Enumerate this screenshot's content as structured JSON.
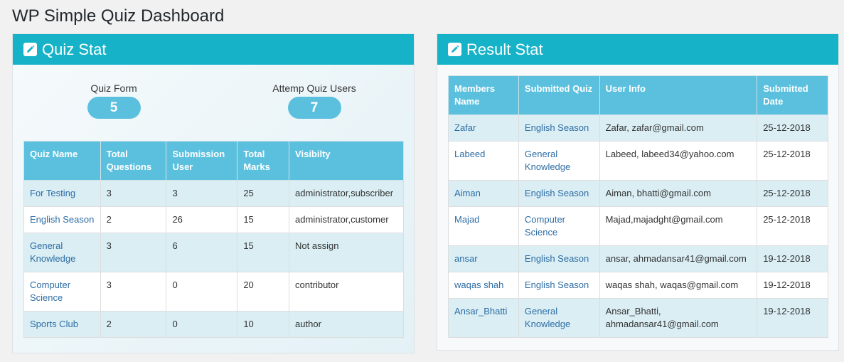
{
  "page": {
    "title": "WP Simple Quiz Dashboard"
  },
  "quiz_stat": {
    "title": "Quiz Stat",
    "icon": "edit-icon",
    "quiz_form_label": "Quiz Form",
    "quiz_form_count": "5",
    "attempt_label": "Attemp Quiz Users",
    "attempt_count": "7",
    "headers": [
      "Quiz Name",
      "Total Questions",
      "Submission User",
      "Total Marks",
      "Visibilty"
    ],
    "rows": [
      {
        "name": "For Testing",
        "questions": "3",
        "submissions": "3",
        "marks": "25",
        "visibility": "administrator,subscriber"
      },
      {
        "name": "English Season",
        "questions": "2",
        "submissions": "26",
        "marks": "15",
        "visibility": "administrator,customer"
      },
      {
        "name": "General Knowledge",
        "questions": "3",
        "submissions": "6",
        "marks": "15",
        "visibility": "Not assign"
      },
      {
        "name": "Computer Science",
        "questions": "3",
        "submissions": "0",
        "marks": "20",
        "visibility": "contributor"
      },
      {
        "name": "Sports Club",
        "questions": "2",
        "submissions": "0",
        "marks": "10",
        "visibility": "author"
      }
    ]
  },
  "result_stat": {
    "title": "Result Stat",
    "icon": "edit-icon",
    "headers": [
      "Members Name",
      "Submitted Quiz",
      "User Info",
      "Submitted Date"
    ],
    "rows": [
      {
        "member": "Zafar",
        "quiz": "English Season",
        "info": "Zafar, zafar@gmail.com",
        "date": "25-12-2018"
      },
      {
        "member": "Labeed",
        "quiz": "General Knowledge",
        "info": "Labeed, labeed34@yahoo.com",
        "date": "25-12-2018"
      },
      {
        "member": "Aiman",
        "quiz": "English Season",
        "info": "Aiman, bhatti@gmail.com",
        "date": "25-12-2018"
      },
      {
        "member": "Majad",
        "quiz": "Computer Science",
        "info": "Majad,majadght@gmail.com",
        "date": "25-12-2018"
      },
      {
        "member": "ansar",
        "quiz": "English Season",
        "info": "ansar, ahmadansar41@gmail.com",
        "date": "19-12-2018"
      },
      {
        "member": "waqas shah",
        "quiz": "English Season",
        "info": "waqas shah, waqas@gmail.com",
        "date": "19-12-2018"
      },
      {
        "member": "Ansar_Bhatti",
        "quiz": "General Knowledge",
        "info": "Ansar_Bhatti, ahmadansar41@gmail.com",
        "date": "19-12-2018"
      }
    ]
  },
  "colors": {
    "header": "#16b3c8",
    "table_header": "#5bc0de",
    "link": "#2e6da4",
    "stripe": "#daeef4"
  }
}
